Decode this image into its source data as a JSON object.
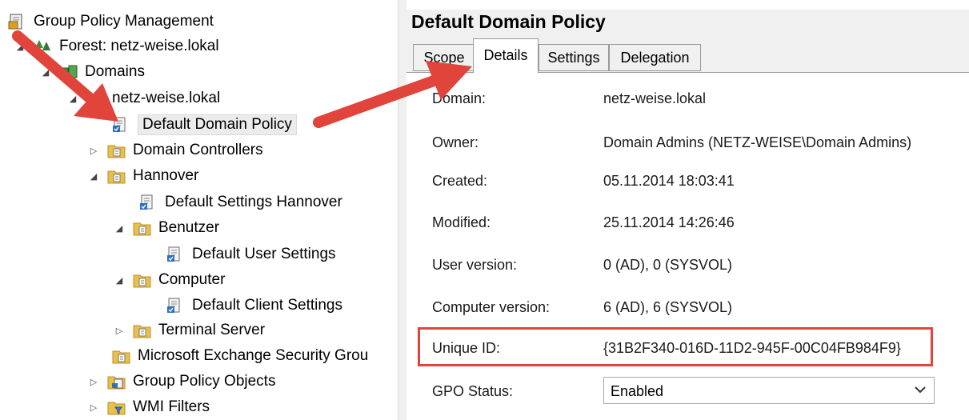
{
  "tree": {
    "root": "Group Policy Management",
    "forest": "Forest: netz-weise.lokal",
    "domains": "Domains",
    "domain": "netz-weise.lokal",
    "default_domain_policy": "Default Domain Policy",
    "domain_controllers": "Domain Controllers",
    "hannover": "Hannover",
    "default_settings_hannover": "Default Settings Hannover",
    "benutzer": "Benutzer",
    "default_user_settings": "Default User Settings",
    "computer": "Computer",
    "default_client_settings": "Default Client Settings",
    "terminal_server": "Terminal Server",
    "exchange_group": "Microsoft Exchange Security Grou",
    "group_policy_objects": "Group Policy Objects",
    "wmi_filters": "WMI Filters"
  },
  "details": {
    "title": "Default Domain Policy",
    "tabs": [
      "Scope",
      "Details",
      "Settings",
      "Delegation"
    ],
    "active_tab": "Details",
    "fields": {
      "domain_label": "Domain:",
      "domain_value": "netz-weise.lokal",
      "owner_label": "Owner:",
      "owner_value": "Domain Admins (NETZ-WEISE\\Domain Admins)",
      "created_label": "Created:",
      "created_value": "05.11.2014 18:03:41",
      "modified_label": "Modified:",
      "modified_value": "25.11.2014 14:26:46",
      "user_version_label": "User version:",
      "user_version_value": "0 (AD), 0 (SYSVOL)",
      "computer_version_label": "Computer version:",
      "computer_version_value": "6 (AD), 6 (SYSVOL)",
      "unique_id_label": "Unique ID:",
      "unique_id_value": "{31B2F340-016D-11D2-945F-00C04FB984F9}",
      "gpo_status_label": "GPO Status:",
      "gpo_status_value": "Enabled"
    }
  },
  "colors": {
    "annotation_red": "#e0443a",
    "highlight_box": "#e0443a",
    "folder_yellow": "#e8c04a"
  }
}
